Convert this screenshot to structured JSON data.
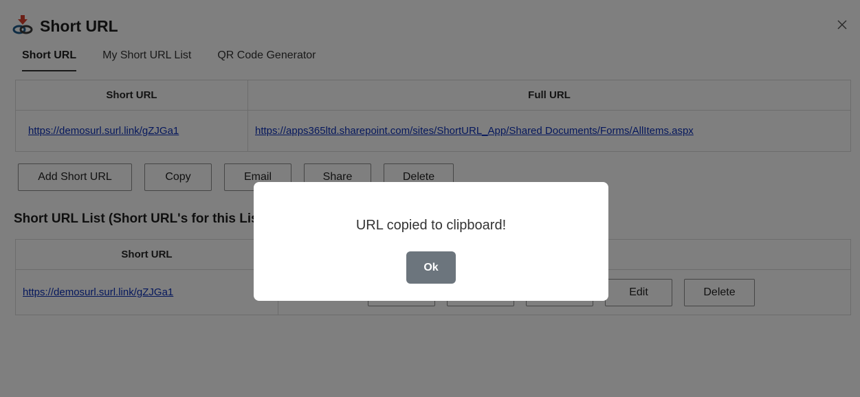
{
  "app": {
    "title": "Short URL"
  },
  "tabs": [
    {
      "label": "Short URL",
      "active": true
    },
    {
      "label": "My Short URL List",
      "active": false
    },
    {
      "label": "QR Code Generator",
      "active": false
    }
  ],
  "current_table": {
    "headers": [
      "Short URL",
      "Full URL"
    ],
    "row": {
      "short_url": "https://demosurl.surl.link/gZJGa1",
      "full_url": "https://apps365ltd.sharepoint.com/sites/ShortURL_App/Shared Documents/Forms/AllItems.aspx"
    }
  },
  "actions": {
    "add": "Add Short URL",
    "copy": "Copy",
    "email": "Email",
    "share": "Share",
    "delete": "Delete"
  },
  "list": {
    "heading": "Short URL List (Short URL's for this List)",
    "headers": [
      "Short URL",
      ""
    ],
    "rows": [
      {
        "short_url": "https://demosurl.surl.link/gZJGa1",
        "buttons": [
          "",
          "",
          "",
          "Edit",
          "Delete"
        ]
      }
    ]
  },
  "dialog": {
    "message": "URL copied to clipboard!",
    "ok_label": "Ok"
  },
  "colors": {
    "link": "#0b2fb8",
    "ok_button": "#6c757d",
    "overlay": "rgba(0,0,0,0.5)"
  }
}
